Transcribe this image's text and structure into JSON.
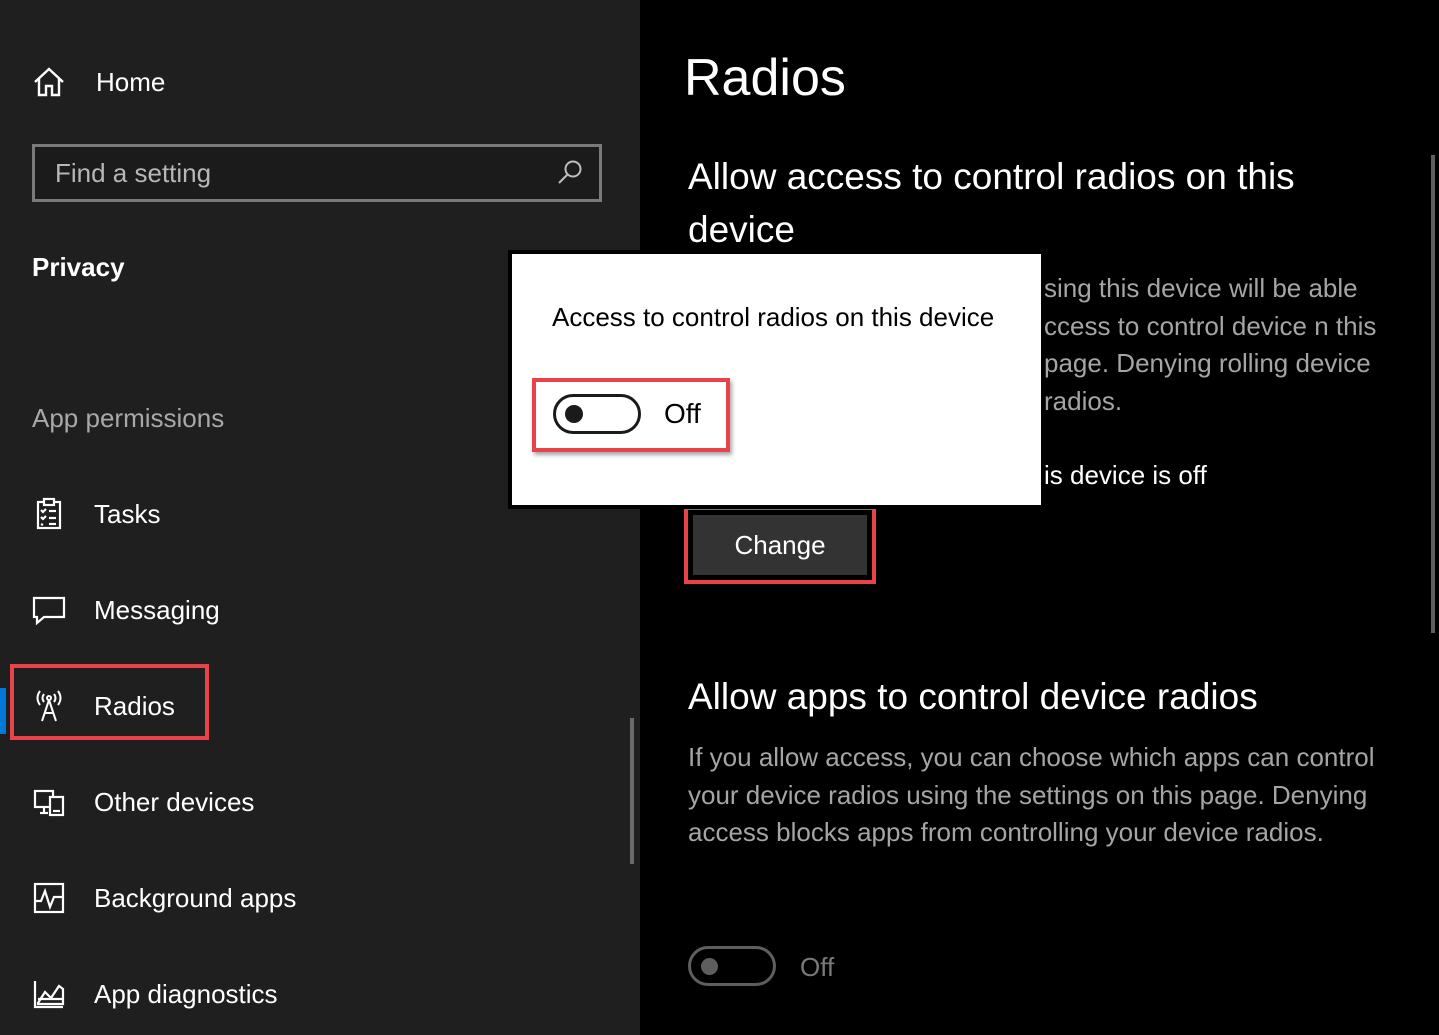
{
  "colors": {
    "sidebar_bg": "#1f1f1f",
    "main_bg": "#000000",
    "accent": "#0078d7",
    "highlight": "#e8434a",
    "flyout_bg": "#ffffff"
  },
  "sidebar": {
    "home": {
      "label": "Home",
      "icon": "home-icon"
    },
    "search": {
      "placeholder": "Find a setting",
      "value": "",
      "icon": "search-icon"
    },
    "section_title": "Privacy",
    "group_title": "App permissions",
    "items": [
      {
        "label": "Tasks",
        "icon": "tasks-icon"
      },
      {
        "label": "Messaging",
        "icon": "messaging-icon"
      },
      {
        "label": "Radios",
        "icon": "radios-icon",
        "selected": true
      },
      {
        "label": "Other devices",
        "icon": "other-devices-icon"
      },
      {
        "label": "Background apps",
        "icon": "background-apps-icon"
      },
      {
        "label": "App diagnostics",
        "icon": "app-diagnostics-icon"
      }
    ]
  },
  "main": {
    "title": "Radios",
    "section1": {
      "heading": "Allow access to control radios on this device",
      "description_visible": "sing this device will be able ccess to control device n this page. Denying rolling device radios.",
      "status_visible": "is device is off",
      "change_button": "Change"
    },
    "section2": {
      "heading": "Allow apps to control device radios",
      "description": "If you allow access, you can choose which apps can control your device radios using the settings on this page. Denying access blocks apps from controlling your device radios.",
      "toggle_state": "Off"
    }
  },
  "flyout": {
    "title": "Access to control radios on this device",
    "toggle_state": "Off"
  }
}
